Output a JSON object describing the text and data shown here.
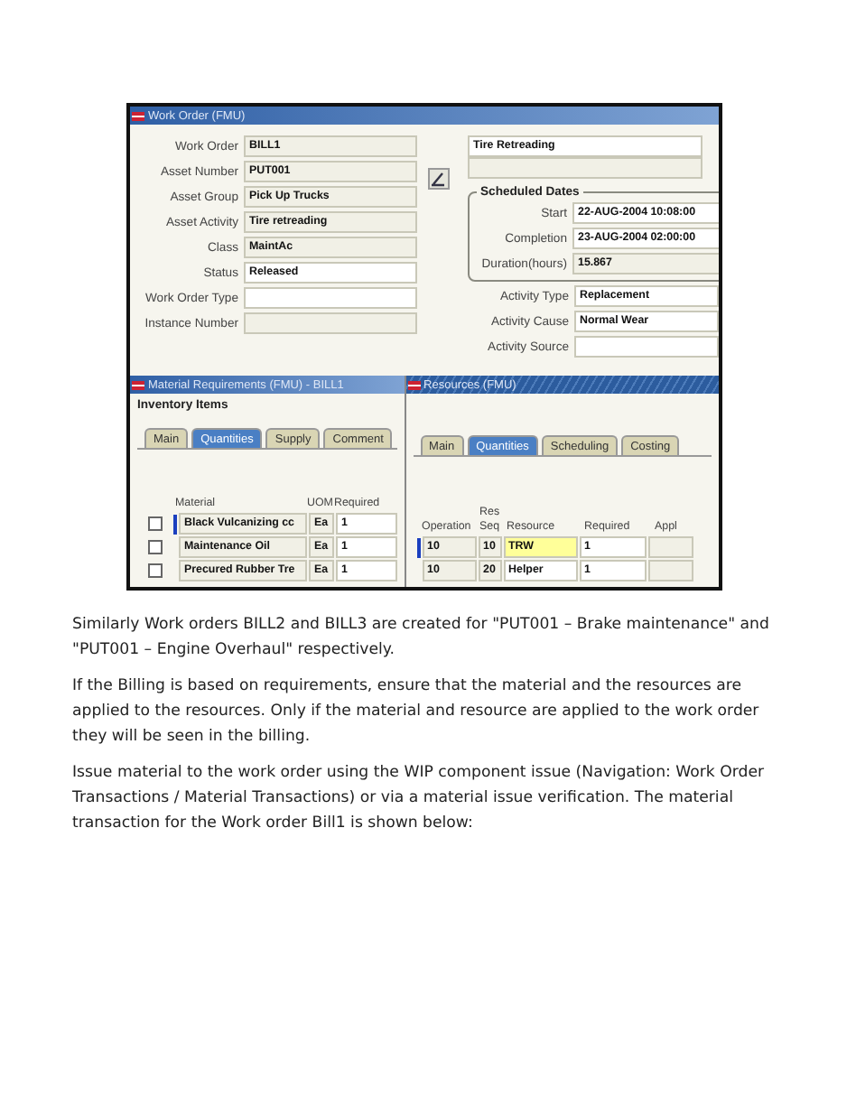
{
  "work_order_window": {
    "title": "Work Order (FMU)",
    "fields": [
      {
        "label": "Work Order",
        "value": "BILL1",
        "editable": false
      },
      {
        "label": "Asset Number",
        "value": "PUT001",
        "editable": false
      },
      {
        "label": "Asset Group",
        "value": "Pick Up Trucks",
        "editable": false
      },
      {
        "label": "Asset Activity",
        "value": "Tire retreading",
        "editable": false
      },
      {
        "label": "Class",
        "value": "MaintAc",
        "editable": false
      },
      {
        "label": "Status",
        "value": "Released",
        "editable": true
      },
      {
        "label": "Work Order Type",
        "editable": true
      },
      {
        "label": "Instance Number",
        "editable": false
      }
    ],
    "description": "Tire Retreading",
    "scheduled_dates": {
      "title": "Scheduled Dates",
      "fields": [
        {
          "label": "Start",
          "value": "22-AUG-2004 10:08:00",
          "editable": true
        },
        {
          "label": "Completion",
          "value": "23-AUG-2004 02:00:00",
          "editable": true
        },
        {
          "label": "Duration(hours)",
          "value": "15.867",
          "editable": false
        }
      ]
    },
    "activity_fields": [
      {
        "label": "Activity Type",
        "value": "Replacement",
        "editable": true
      },
      {
        "label": "Activity Cause",
        "value": "Normal Wear",
        "editable": true
      },
      {
        "label": "Activity Source",
        "editable": true
      }
    ]
  },
  "material_window": {
    "title": "Material Requirements (FMU) - BILL1",
    "group_title": "Inventory Items",
    "tabs": [
      {
        "label": "Main",
        "selected": false
      },
      {
        "label": "Quantities",
        "selected": true
      },
      {
        "label": "Supply",
        "selected": false
      },
      {
        "label": "Comment",
        "selected": false
      }
    ],
    "columns": [
      "Material",
      "UOM",
      "Required"
    ],
    "rows": [
      {
        "checked": false,
        "current": true,
        "material": "Black Vulcanizing cc",
        "uom": "Ea",
        "required": "1"
      },
      {
        "checked": false,
        "current": false,
        "material": "Maintenance Oil",
        "uom": "Ea",
        "required": "1"
      },
      {
        "checked": false,
        "current": false,
        "material": "Precured Rubber Tre",
        "uom": "Ea",
        "required": "1"
      }
    ]
  },
  "resources_window": {
    "title": "Resources (FMU)",
    "tabs": [
      {
        "label": "Main",
        "selected": false
      },
      {
        "label": "Quantities",
        "selected": true
      },
      {
        "label": "Scheduling",
        "selected": false
      },
      {
        "label": "Costing",
        "selected": false
      }
    ],
    "columns": [
      "Operation",
      "Res Seq",
      "Resource",
      "Required",
      "Appl"
    ],
    "rows": [
      {
        "current": true,
        "operation": "10",
        "seq": "10",
        "resource": "TRW",
        "required": "1",
        "focused": true
      },
      {
        "current": false,
        "operation": "10",
        "seq": "20",
        "resource": "Helper",
        "required": "1",
        "focused": false
      }
    ]
  },
  "paragraphs": [
    "Similarly  Work orders BILL2 and BILL3 are created for \"PUT001 – Brake maintenance\" and \"PUT001 – Engine Overhaul\" respectively.",
    "If the Billing  is based on requirements,  ensure that the material and the resources are applied to the resources. Only if the material and resource are applied to the work order they will be seen in the billing.",
    "Issue material to the work order using the WIP component issue (Navigation: Work Order Transactions / Material Transactions) or via a material issue verification. The material transaction for the Work order Bill1 is shown below:"
  ]
}
